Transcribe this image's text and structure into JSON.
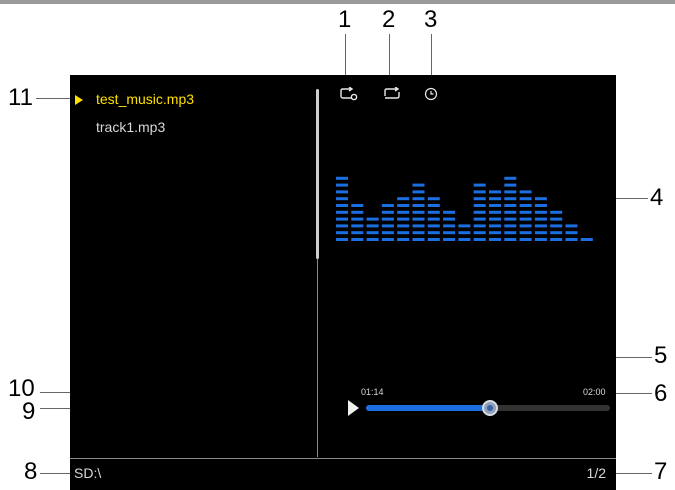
{
  "labels": {
    "n1": "1",
    "n2": "2",
    "n3": "3",
    "n4": "4",
    "n5": "5",
    "n6": "6",
    "n7": "7",
    "n8": "8",
    "n9": "9",
    "n10": "10",
    "n11": "11"
  },
  "playlist": {
    "items": [
      "test_music.mp3",
      "track1.mp3"
    ],
    "active_index": 0
  },
  "player": {
    "current_time": "01:14",
    "total_time": "02:00",
    "progress": 0.51,
    "scroll_position": 0.0
  },
  "status": {
    "path": "SD:\\",
    "page": "1/2"
  },
  "icons": [
    "repeat-one-icon",
    "repeat-all-icon",
    "timer-icon"
  ],
  "equalizer": {
    "bar_levels": [
      10,
      6,
      4,
      6,
      7,
      9,
      7,
      5,
      3,
      9,
      8,
      10,
      8,
      7,
      5,
      3,
      1
    ],
    "color": "#1c6fe0"
  },
  "colors": {
    "background": "#000000",
    "active_text": "#ffe000",
    "text": "#d8d8d8",
    "accent": "#1c6fe0"
  }
}
